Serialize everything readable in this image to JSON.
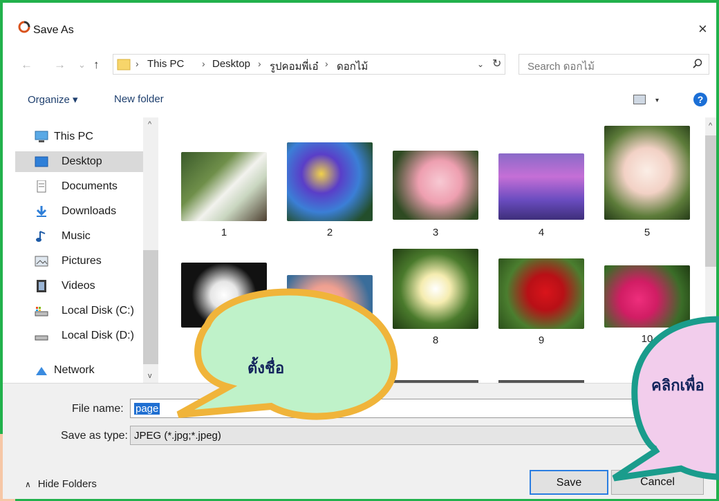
{
  "window": {
    "title": "Save As",
    "close_glyph": "×"
  },
  "nav": {
    "back": "←",
    "forward": "→",
    "recent": "⌄",
    "up": "↑"
  },
  "breadcrumbs": [
    "This PC",
    "Desktop",
    "รูปคอมพี่เอ๋",
    "ดอกไม้"
  ],
  "breadcrumb_sep": "›",
  "address_dropdown": "⌄",
  "refresh_glyph": "↻",
  "search": {
    "placeholder": "Search ดอกไม้"
  },
  "toolbar": {
    "organize": "Organize ▾",
    "new_folder": "New folder",
    "view_drop": "▾",
    "help": "?"
  },
  "sidebar": {
    "items": [
      {
        "label": "This PC",
        "icon": "computer-icon"
      },
      {
        "label": "Desktop",
        "icon": "desktop-icon",
        "selected": true
      },
      {
        "label": "Documents",
        "icon": "documents-icon"
      },
      {
        "label": "Downloads",
        "icon": "downloads-icon"
      },
      {
        "label": "Music",
        "icon": "music-icon"
      },
      {
        "label": "Pictures",
        "icon": "pictures-icon"
      },
      {
        "label": "Videos",
        "icon": "videos-icon"
      },
      {
        "label": "Local Disk (C:)",
        "icon": "disk-c-icon"
      },
      {
        "label": "Local Disk (D:)",
        "icon": "disk-d-icon"
      },
      {
        "label": "Network",
        "icon": "network-icon"
      }
    ]
  },
  "files": [
    {
      "name": "1"
    },
    {
      "name": "2"
    },
    {
      "name": "3"
    },
    {
      "name": "4"
    },
    {
      "name": "5"
    },
    {
      "name": ""
    },
    {
      "name": ""
    },
    {
      "name": "8"
    },
    {
      "name": "9"
    },
    {
      "name": "10"
    }
  ],
  "form": {
    "file_name_label": "File name:",
    "file_name_value": "page",
    "save_type_label": "Save as type:",
    "save_type_value": "JPEG (*.jpg;*.jpeg)"
  },
  "footer": {
    "hide_folders": "Hide Folders",
    "save": "Save",
    "cancel": "Cancel"
  },
  "callouts": {
    "name_it": "ตั้งชื่อ",
    "click_to": "คลิกเพื่อ"
  },
  "colors": {
    "frame": "#22b14c",
    "accent": "#1f6fd1",
    "bubble_yellow_border": "#f0b43a",
    "bubble_teal_border": "#1a9c8c"
  }
}
